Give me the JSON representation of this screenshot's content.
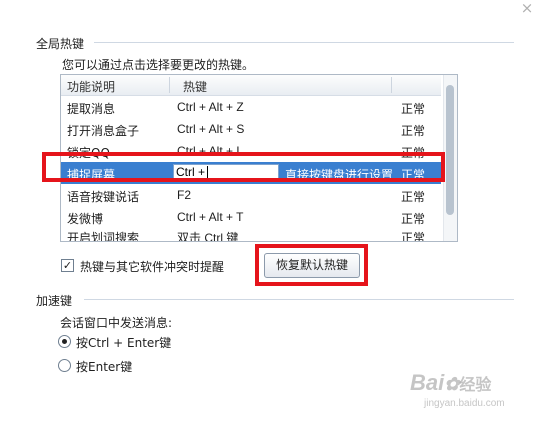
{
  "window": {
    "close_glyph": "×"
  },
  "global_hotkeys": {
    "title": "全局热键",
    "description": "您可以通过点击选择要更改的热键。",
    "columns": {
      "function": "功能说明",
      "hotkey": "热键"
    },
    "rows": [
      {
        "function": "提取消息",
        "hotkey": "Ctrl + Alt + Z",
        "status": "正常"
      },
      {
        "function": "打开消息盒子",
        "hotkey": "Ctrl + Alt + S",
        "status": "正常"
      },
      {
        "function": "锁定QQ",
        "hotkey": "Ctrl + Alt + L",
        "status": "正常"
      },
      {
        "function": "捕捉屏幕",
        "hotkey": "Ctrl +",
        "status": "正常",
        "hint": "直接按键盘进行设置",
        "selected": true
      },
      {
        "function": "语音按键说话",
        "hotkey": "F2",
        "status": "正常"
      },
      {
        "function": "发微博",
        "hotkey": "Ctrl + Alt + T",
        "status": "正常"
      },
      {
        "function": "开启划词搜索",
        "hotkey": "双击 Ctrl 键",
        "status": "正常"
      }
    ],
    "conflict_checkbox": {
      "label": "热键与其它软件冲突时提醒",
      "checked": true
    },
    "restore_button": "恢复默认热键"
  },
  "accelerator": {
    "title": "加速键",
    "subtitle": "会话窗口中发送消息:",
    "options": [
      {
        "label": "按Ctrl + Enter键",
        "selected": true
      },
      {
        "label": "按Enter键",
        "selected": false
      }
    ]
  },
  "watermark": {
    "brand": "Bai",
    "brand2": "经验",
    "url": "jingyan.baidu.com"
  },
  "colors": {
    "selected_row": "#3a7fd0",
    "highlight": "#e5141b"
  }
}
